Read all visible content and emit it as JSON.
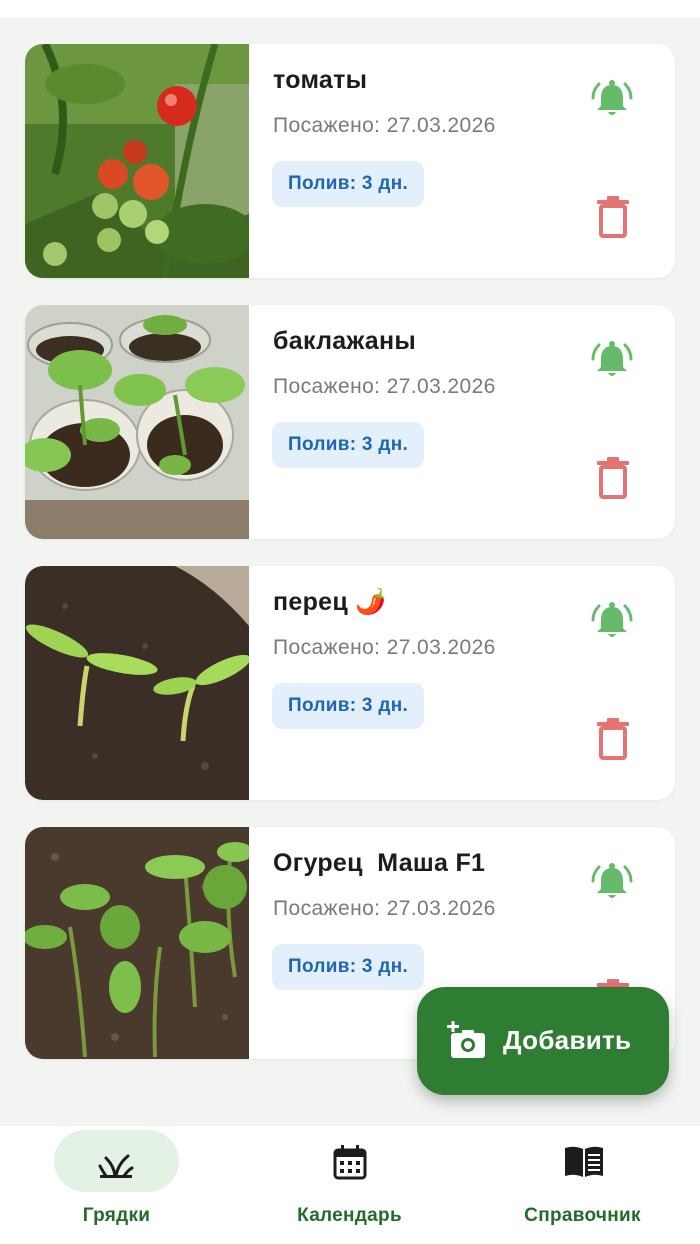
{
  "colors": {
    "primary": "#2e7d32",
    "bell": "#66bb6a",
    "delete": "#e57373",
    "water_badge_bg": "#e3f0fb",
    "water_badge_text": "#1f66b3"
  },
  "beds": [
    {
      "name": "томаты",
      "planted": "Посажено: 27.03.2026",
      "water": "Полив: 3 дн.",
      "photo": "tomato-photo"
    },
    {
      "name": "баклажаны",
      "planted": "Посажено: 27.03.2026",
      "water": "Полив: 3 дн.",
      "photo": "eggplant-seedlings-photo"
    },
    {
      "name": "перец 🌶️",
      "planted": "Посажено: 27.03.2026",
      "water": "Полив: 3 дн.",
      "photo": "pepper-seedlings-photo"
    },
    {
      "name": "Огурец  Маша F1",
      "planted": "Посажено: 27.03.2026",
      "water": "Полив: 3 дн.",
      "photo": "cucumber-seedlings-photo"
    }
  ],
  "fab": {
    "label": "Добавить",
    "icon": "add-photo-icon"
  },
  "nav": [
    {
      "label": "Грядки",
      "icon": "sprout-icon",
      "active": true
    },
    {
      "label": "Календарь",
      "icon": "calendar-icon",
      "active": false
    },
    {
      "label": "Справочник",
      "icon": "book-icon",
      "active": false
    }
  ]
}
